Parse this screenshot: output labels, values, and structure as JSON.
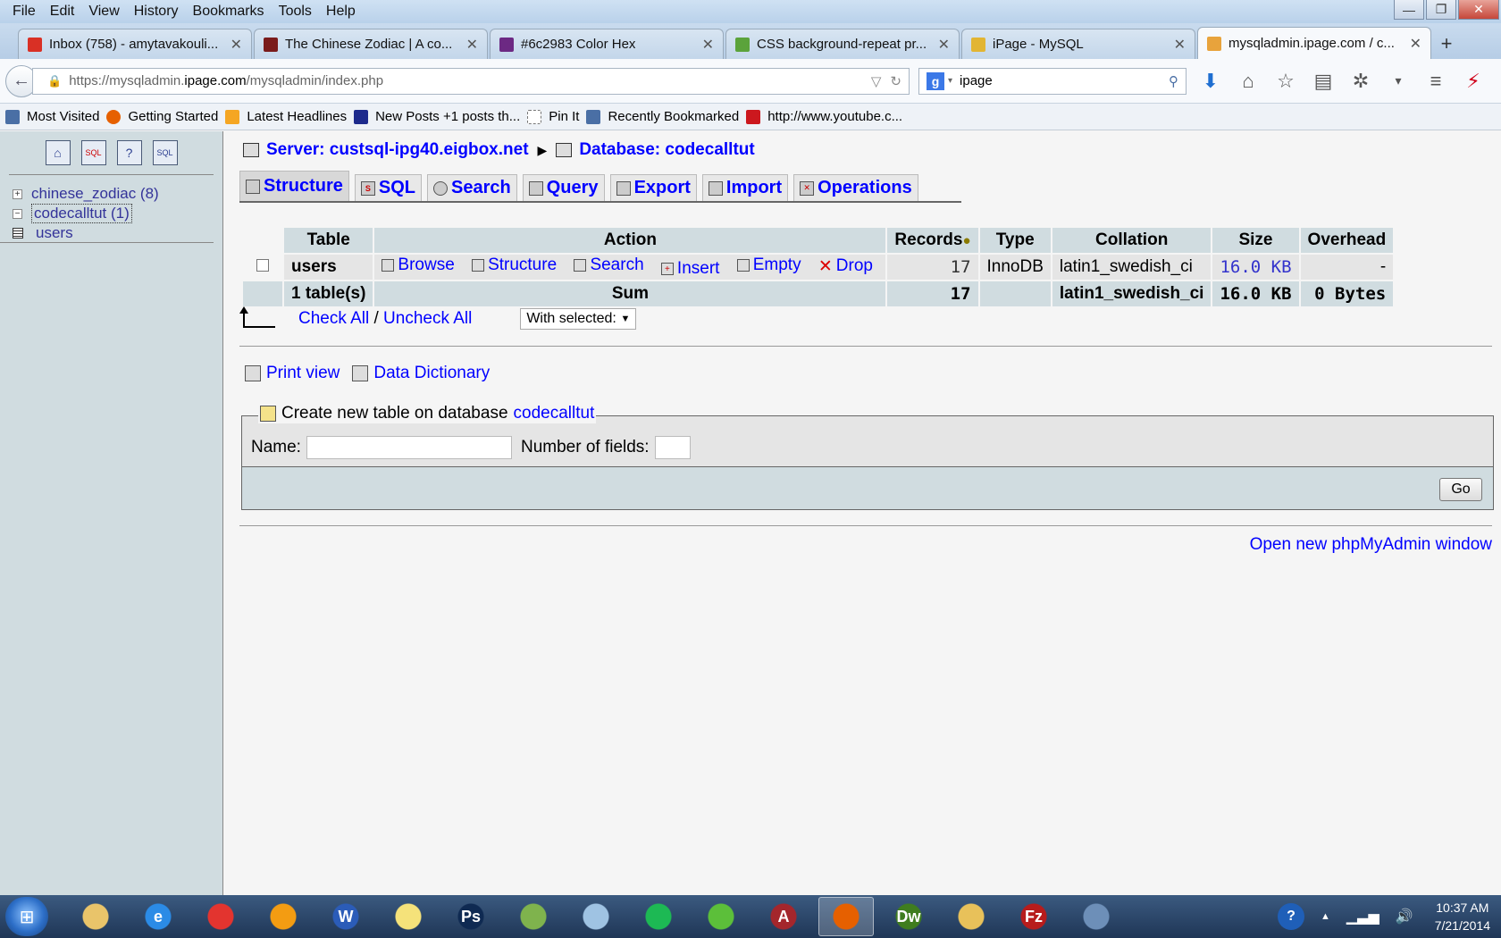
{
  "menubar": {
    "items": [
      "File",
      "Edit",
      "View",
      "History",
      "Bookmarks",
      "Tools",
      "Help"
    ]
  },
  "browser_tabs": [
    {
      "label": "Inbox (758) - amytavakouli...",
      "icon_color": "#d93025"
    },
    {
      "label": "The Chinese Zodiac | A co...",
      "icon_color": "#7a1b1b"
    },
    {
      "label": "#6c2983 Color Hex",
      "icon_color": "#6c2983"
    },
    {
      "label": "CSS background-repeat pr...",
      "icon_color": "#5ba33b"
    },
    {
      "label": "iPage - MySQL",
      "icon_color": "#e2b533"
    },
    {
      "label": "mysqladmin.ipage.com / c...",
      "icon_color": "#e8a33c"
    }
  ],
  "address": {
    "url_prefix": "https://mysqladmin.",
    "url_domain": "ipage.com",
    "url_suffix": "/mysqladmin/index.php"
  },
  "search": {
    "value": "ipage"
  },
  "bookmarks": [
    {
      "label": "Most Visited",
      "icon_color": "#4a6fa5"
    },
    {
      "label": "Getting Started",
      "icon_color": "#e66000"
    },
    {
      "label": "Latest Headlines",
      "icon_color": "#f5a623"
    },
    {
      "label": "New Posts +1 posts th...",
      "icon_color": "#1d2a8c"
    },
    {
      "label": "Pin It",
      "icon_color": "#ffffff"
    },
    {
      "label": "Recently Bookmarked",
      "icon_color": "#4a6fa5"
    },
    {
      "label": "http://www.youtube.c...",
      "icon_color": "#cc181e"
    }
  ],
  "sidebar": {
    "databases": [
      {
        "expander": "+",
        "name": "chinese_zodiac (8)"
      },
      {
        "expander": "−",
        "name": "codecalltut (1)"
      }
    ],
    "tables": [
      "users"
    ]
  },
  "breadcrumb": {
    "server": "Server: custsql-ipg40.eigbox.net",
    "database": "Database: codecalltut"
  },
  "page_tabs": [
    {
      "label": "Structure",
      "icon": "structure-icon"
    },
    {
      "label": "SQL",
      "icon": "sql-icon"
    },
    {
      "label": "Search",
      "icon": "search-icon"
    },
    {
      "label": "Query",
      "icon": "query-icon"
    },
    {
      "label": "Export",
      "icon": "export-icon"
    },
    {
      "label": "Import",
      "icon": "import-icon"
    },
    {
      "label": "Operations",
      "icon": "operations-icon"
    }
  ],
  "table": {
    "headers": {
      "table": "Table",
      "action": "Action",
      "records": "Records",
      "type": "Type",
      "collation": "Collation",
      "size": "Size",
      "overhead": "Overhead"
    },
    "rows": [
      {
        "name": "users",
        "actions": [
          "Browse",
          "Structure",
          "Search",
          "Insert",
          "Empty",
          "Drop"
        ],
        "records": "17",
        "type": "InnoDB",
        "collation": "latin1_swedish_ci",
        "size": "16.0 KB",
        "overhead": "-"
      }
    ],
    "sum": {
      "label": "1 table(s)",
      "action": "Sum",
      "records": "17",
      "collation": "latin1_swedish_ci",
      "size": "16.0 KB",
      "overhead": "0 Bytes"
    }
  },
  "check": {
    "check_all": "Check All",
    "separator": " / ",
    "uncheck_all": "Uncheck All",
    "with_selected": "With selected:"
  },
  "links": {
    "print_view": "Print view",
    "data_dictionary": "Data Dictionary"
  },
  "create_table": {
    "legend": "Create new table on database",
    "database": "codecalltut",
    "name_label": "Name:",
    "fields_label": "Number of fields:",
    "go": "Go"
  },
  "open_window": "Open new phpMyAdmin window",
  "taskbar": {
    "apps": [
      {
        "label": "",
        "icon": "paint-icon",
        "color": "#e9c46a"
      },
      {
        "label": "e",
        "icon": "ie-icon",
        "color": "#2b8be6"
      },
      {
        "label": "",
        "icon": "chrome-icon",
        "color": "#e3342f"
      },
      {
        "label": "",
        "icon": "media-player-icon",
        "color": "#f39c12"
      },
      {
        "label": "W",
        "icon": "word-icon",
        "color": "#2b5cb8"
      },
      {
        "label": "",
        "icon": "sticky-notes-icon",
        "color": "#f5e27a"
      },
      {
        "label": "Ps",
        "icon": "photoshop-icon",
        "color": "#0f2a52"
      },
      {
        "label": "",
        "icon": "notepad-plus-icon",
        "color": "#7fb34d"
      },
      {
        "label": "",
        "icon": "notepad-icon",
        "color": "#9fc3e3"
      },
      {
        "label": "",
        "icon": "spotify-icon",
        "color": "#1db954"
      },
      {
        "label": "",
        "icon": "game-icon",
        "color": "#5cbf3a"
      },
      {
        "label": "A",
        "icon": "access-icon",
        "color": "#a4262c"
      },
      {
        "label": "",
        "icon": "firefox-icon",
        "color": "#e66000"
      },
      {
        "label": "Dw",
        "icon": "dreamweaver-icon",
        "color": "#3f7d1f"
      },
      {
        "label": "",
        "icon": "folder-icon",
        "color": "#e8c15a"
      },
      {
        "label": "Fz",
        "icon": "filezilla-icon",
        "color": "#b71c1c"
      },
      {
        "label": "",
        "icon": "window-icon",
        "color": "#6d8fb8"
      }
    ],
    "time": "10:37 AM",
    "date": "7/21/2014"
  }
}
